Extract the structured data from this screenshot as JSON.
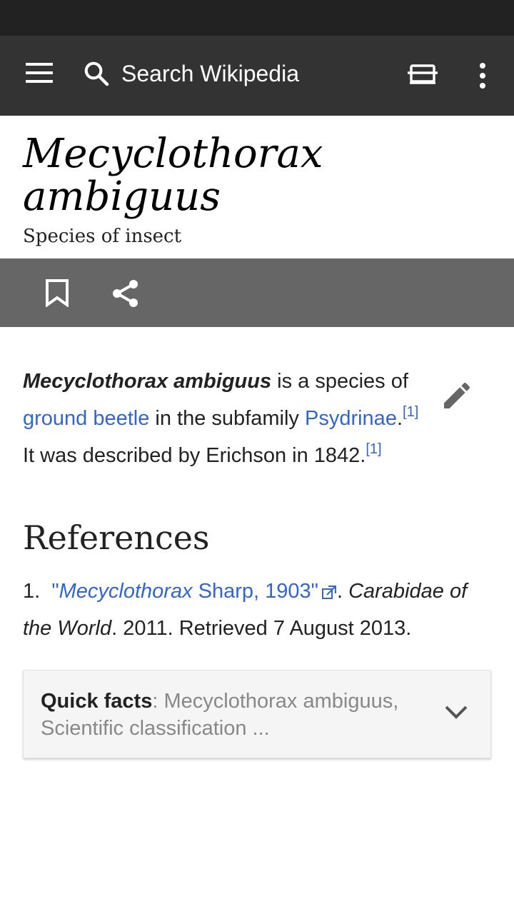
{
  "toolbar": {
    "search_placeholder": "Search Wikipedia",
    "icons": [
      "menu-icon",
      "search-icon",
      "reading-list-icon",
      "overflow-menu-icon"
    ]
  },
  "page": {
    "title_line1": "Mecyclothorax",
    "title_line2": "ambiguus",
    "subtitle": "Species of insect"
  },
  "actions": {
    "icons": [
      "bookmark-icon",
      "share-icon"
    ]
  },
  "article": {
    "lead_bold": "Mecyclothorax ambiguus",
    "text1": " is a species of ",
    "link1": "ground beetle",
    "text2": " in the subfamily ",
    "link2": "Psydrinae",
    "text3": ".",
    "cite1": "[1]",
    "text4": " It was described by Erichson in 1842.",
    "cite2": "[1]"
  },
  "references": {
    "heading": "References",
    "items": [
      {
        "number": "1.",
        "link_italic": "Mecyclothorax",
        "link_rest": " Sharp, 1903\"",
        "link_open_quote": "\"",
        "sep": ". ",
        "work": "Carabidae of the World",
        "rest": ". 2011. Retrieved 7 August 2013."
      }
    ]
  },
  "quick_facts": {
    "label": "Quick facts",
    "sep": ": ",
    "summary": "Mecyclothorax ambiguus, Scientific classification ..."
  },
  "colors": {
    "toolbar": "#333333",
    "status_bar": "#222222",
    "action_bar": "#666666",
    "link": "#3366cc"
  }
}
